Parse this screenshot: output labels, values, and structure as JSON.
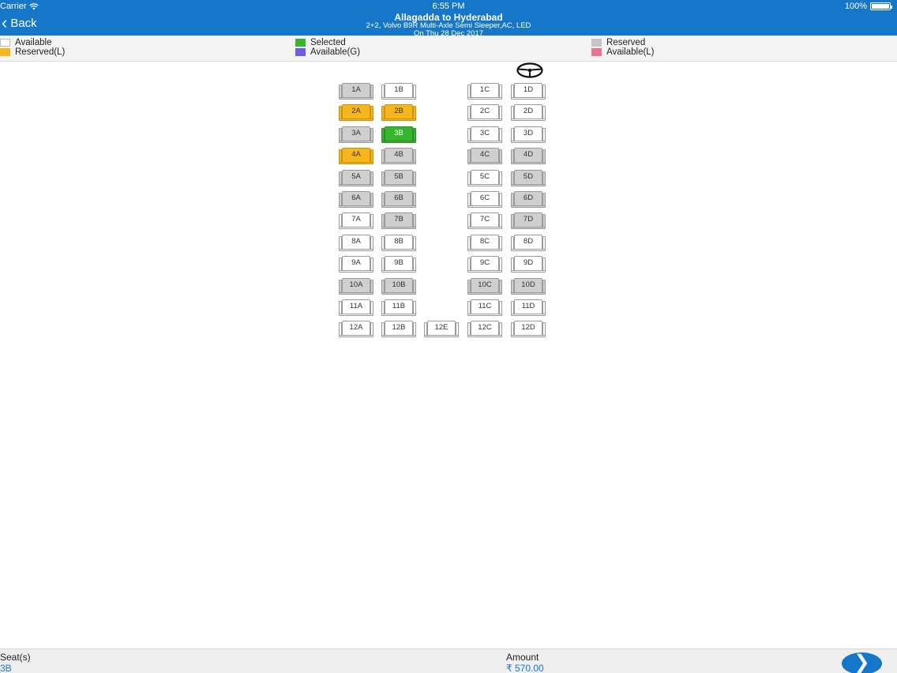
{
  "status_bar": {
    "carrier": "Carrier",
    "time": "6:55 PM",
    "battery": "100%"
  },
  "header": {
    "back_label": "Back",
    "title": "Allagadda to Hyderabad",
    "subtitle": "2+2, Volvo B9R Multi-Axle Semi Sleeper,AC, LED",
    "date": "On Thu 28 Dec 2017"
  },
  "colors": {
    "accent": "#1677c9",
    "available": "#ffffff",
    "selected": "#37b52e",
    "reserved": "#c5c5c5",
    "reserved_l": "#f6b71e",
    "available_g": "#6e5be8",
    "available_l": "#ef7390"
  },
  "legend": {
    "available": "Available",
    "selected": "Selected",
    "reserved": "Reserved",
    "reserved_l": "Reserved(L)",
    "available_g": "Available(G)",
    "available_l": "Available(L)"
  },
  "icons": {
    "driver": "steering-wheel-icon",
    "next": "chevron-right-icon",
    "back": "chevron-left-icon"
  },
  "seats": [
    {
      "label": "1A",
      "status": "reserved"
    },
    {
      "label": "1B",
      "status": "available"
    },
    {
      "label": "1C",
      "status": "available"
    },
    {
      "label": "1D",
      "status": "available"
    },
    {
      "label": "2A",
      "status": "reserved_l"
    },
    {
      "label": "2B",
      "status": "reserved_l"
    },
    {
      "label": "2C",
      "status": "available"
    },
    {
      "label": "2D",
      "status": "available"
    },
    {
      "label": "3A",
      "status": "reserved"
    },
    {
      "label": "3B",
      "status": "selected"
    },
    {
      "label": "3C",
      "status": "available"
    },
    {
      "label": "3D",
      "status": "available"
    },
    {
      "label": "4A",
      "status": "reserved_l"
    },
    {
      "label": "4B",
      "status": "reserved"
    },
    {
      "label": "4C",
      "status": "reserved"
    },
    {
      "label": "4D",
      "status": "reserved"
    },
    {
      "label": "5A",
      "status": "reserved"
    },
    {
      "label": "5B",
      "status": "reserved"
    },
    {
      "label": "5C",
      "status": "available"
    },
    {
      "label": "5D",
      "status": "reserved"
    },
    {
      "label": "6A",
      "status": "reserved"
    },
    {
      "label": "6B",
      "status": "reserved"
    },
    {
      "label": "6C",
      "status": "available"
    },
    {
      "label": "6D",
      "status": "reserved"
    },
    {
      "label": "7A",
      "status": "available"
    },
    {
      "label": "7B",
      "status": "reserved"
    },
    {
      "label": "7C",
      "status": "available"
    },
    {
      "label": "7D",
      "status": "reserved"
    },
    {
      "label": "8A",
      "status": "available"
    },
    {
      "label": "8B",
      "status": "available"
    },
    {
      "label": "8C",
      "status": "available"
    },
    {
      "label": "8D",
      "status": "available"
    },
    {
      "label": "9A",
      "status": "available"
    },
    {
      "label": "9B",
      "status": "available"
    },
    {
      "label": "9C",
      "status": "available"
    },
    {
      "label": "9D",
      "status": "available"
    },
    {
      "label": "10A",
      "status": "reserved"
    },
    {
      "label": "10B",
      "status": "reserved"
    },
    {
      "label": "10C",
      "status": "reserved"
    },
    {
      "label": "10D",
      "status": "reserved"
    },
    {
      "label": "11A",
      "status": "available"
    },
    {
      "label": "11B",
      "status": "available"
    },
    {
      "label": "11C",
      "status": "available"
    },
    {
      "label": "11D",
      "status": "available"
    },
    {
      "label": "12A",
      "status": "available"
    },
    {
      "label": "12B",
      "status": "available"
    },
    {
      "label": "12E",
      "status": "available"
    },
    {
      "label": "12C",
      "status": "available"
    },
    {
      "label": "12D",
      "status": "available"
    }
  ],
  "footer": {
    "seat_label": "Seat(s)",
    "seat_value": "3B",
    "amount_label": "Amount",
    "amount_value": "₹ 570.00"
  }
}
